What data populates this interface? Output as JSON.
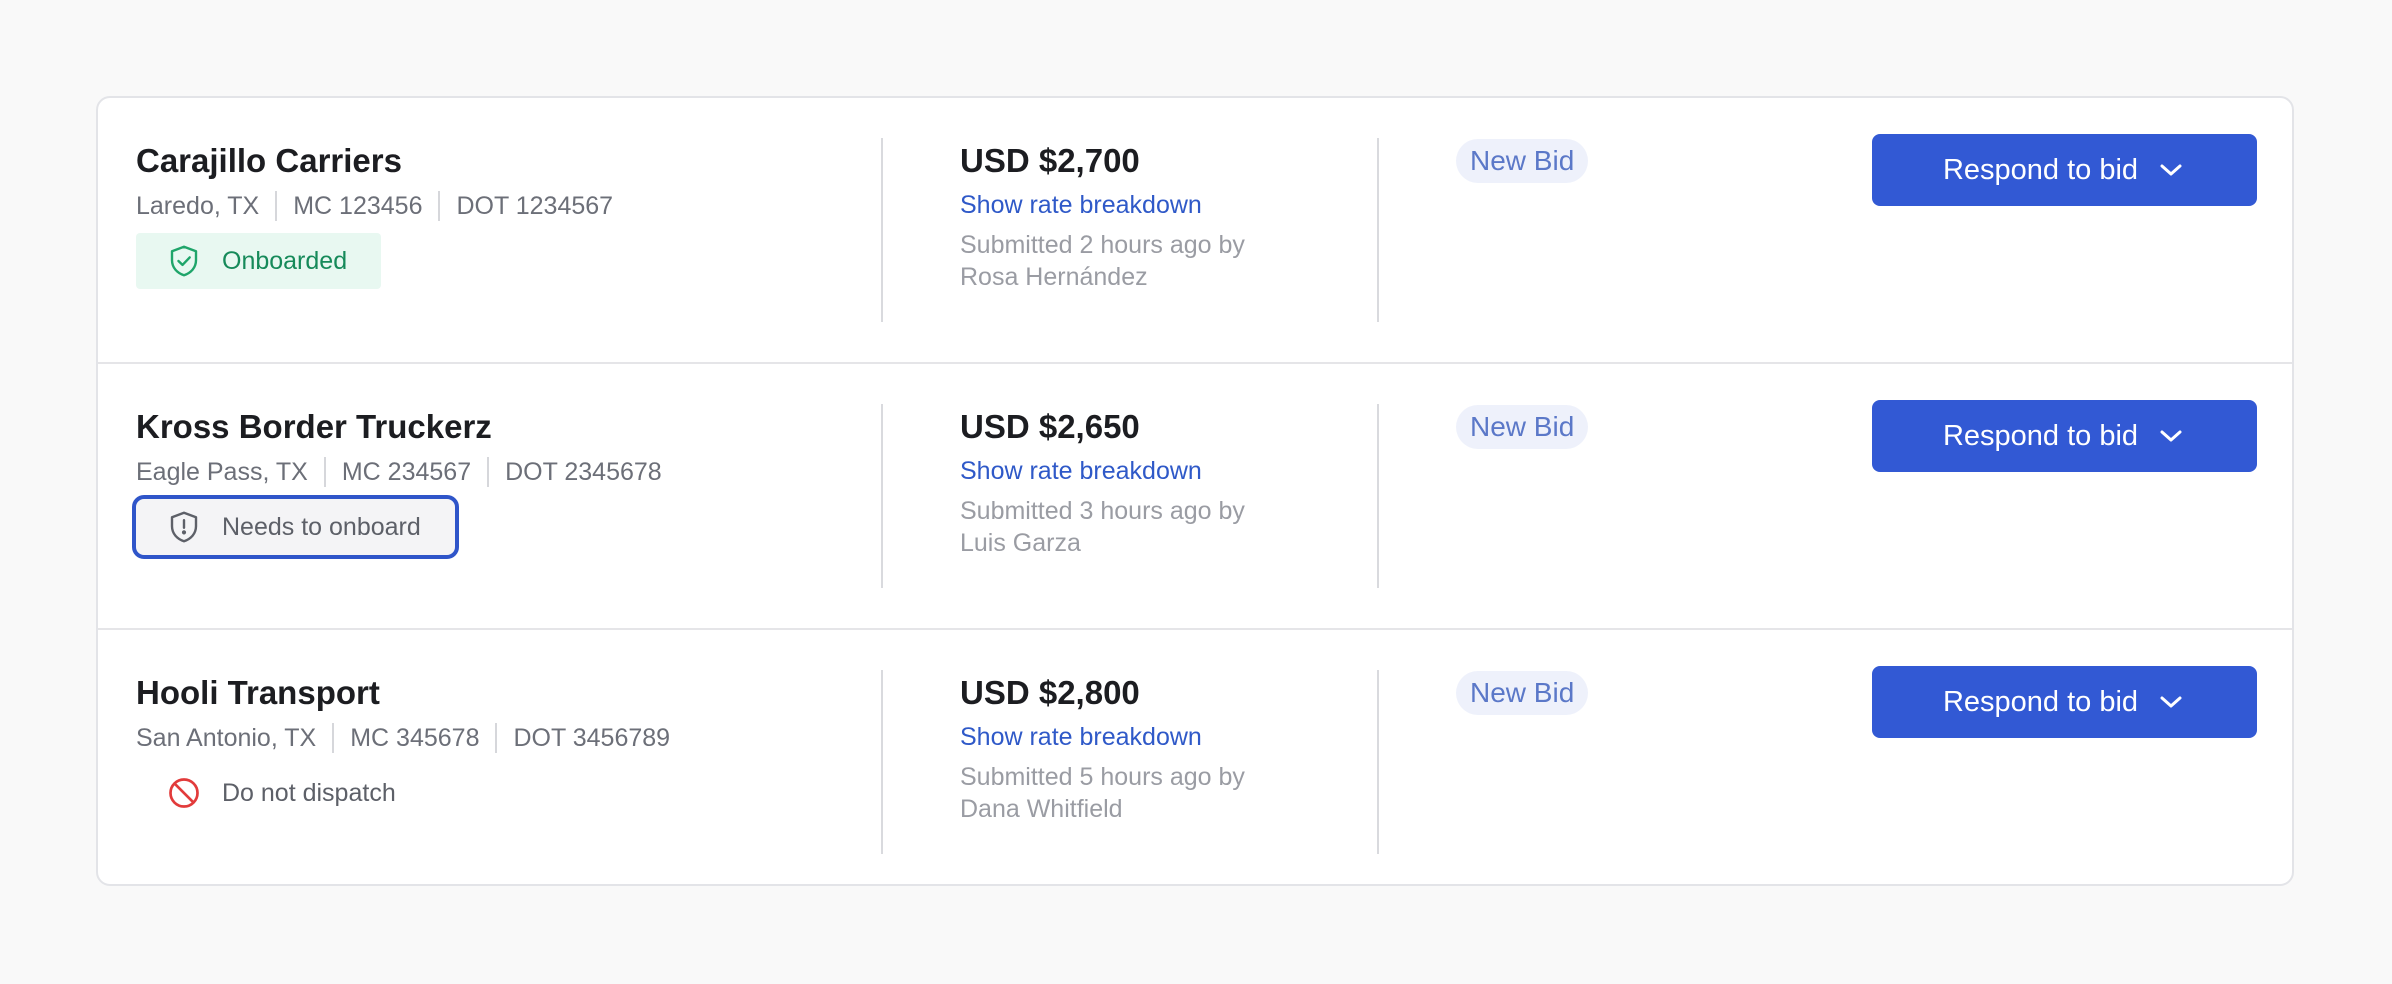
{
  "colors": {
    "accent": "#3259d4",
    "link": "#2f59c8",
    "onboarded_bg": "#e8f8f1",
    "onboarded_text": "#168a5a",
    "danger": "#e23b3b",
    "tag_bg": "#eef1fb"
  },
  "bids": [
    {
      "carrier": "Carajillo Carriers",
      "location": "Laredo, TX",
      "mc": "MC 123456",
      "dot": "DOT 1234567",
      "status": "Onboarded",
      "status_icon": "shield-check-icon",
      "price": "USD $2,700",
      "breakdown_link": "Show rate breakdown",
      "submitted_line1": "Submitted 2 hours ago by",
      "submitted_by": "Rosa Hernández",
      "tag": "New Bid",
      "action_label": "Respond to bid",
      "action_icon": "chevron-down-icon"
    },
    {
      "carrier": "Kross Border Truckerz",
      "location": "Eagle Pass, TX",
      "mc": "MC 234567",
      "dot": "DOT 2345678",
      "status": "Needs to onboard",
      "status_icon": "shield-alert-icon",
      "price": "USD $2,650",
      "breakdown_link": "Show rate breakdown",
      "submitted_line1": "Submitted 3 hours ago by",
      "submitted_by": "Luis Garza",
      "tag": "New Bid",
      "action_label": "Respond to bid",
      "action_icon": "chevron-down-icon"
    },
    {
      "carrier": "Hooli Transport",
      "location": "San Antonio, TX",
      "mc": "MC 345678",
      "dot": "DOT 3456789",
      "status": "Do not dispatch",
      "status_icon": "prohibited-icon",
      "price": "USD $2,800",
      "breakdown_link": "Show rate breakdown",
      "submitted_line1": "Submitted 5 hours ago by",
      "submitted_by": "Dana Whitfield",
      "tag": "New Bid",
      "action_label": "Respond to bid",
      "action_icon": "chevron-down-icon"
    }
  ]
}
